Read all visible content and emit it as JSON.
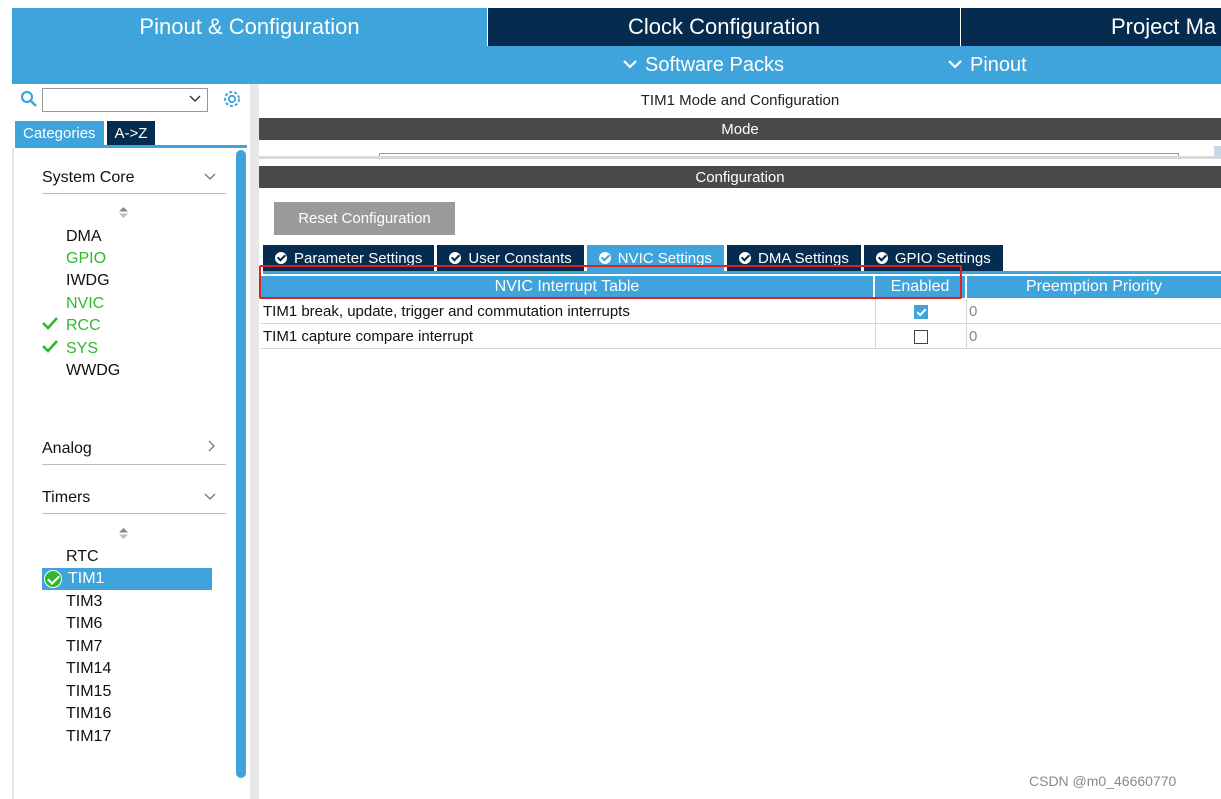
{
  "top_tabs": [
    {
      "label": "Pinout & Configuration"
    },
    {
      "label": "Clock Configuration"
    },
    {
      "label": "Project Ma"
    }
  ],
  "sub_menu": {
    "software_packs": "Software Packs",
    "pinout": "Pinout"
  },
  "sidebar": {
    "categories_tab": "Categories",
    "az_tab": "A->Z",
    "groups": {
      "system_core": {
        "label": "System Core",
        "items": [
          {
            "label": "DMA"
          },
          {
            "label": "GPIO"
          },
          {
            "label": "IWDG"
          },
          {
            "label": "NVIC"
          },
          {
            "label": "RCC"
          },
          {
            "label": "SYS"
          },
          {
            "label": "WWDG"
          }
        ]
      },
      "analog": {
        "label": "Analog"
      },
      "timers": {
        "label": "Timers",
        "items": [
          {
            "label": "RTC"
          },
          {
            "label": "TIM1"
          },
          {
            "label": "TIM3"
          },
          {
            "label": "TIM6"
          },
          {
            "label": "TIM7"
          },
          {
            "label": "TIM14"
          },
          {
            "label": "TIM15"
          },
          {
            "label": "TIM16"
          },
          {
            "label": "TIM17"
          }
        ]
      }
    }
  },
  "main": {
    "title": "TIM1 Mode and Configuration",
    "mode_label": "Mode",
    "configuration_label": "Configuration",
    "reset_button": "Reset Configuration",
    "tabs": [
      {
        "label": "Parameter Settings"
      },
      {
        "label": "User Constants"
      },
      {
        "label": "NVIC Settings"
      },
      {
        "label": "DMA Settings"
      },
      {
        "label": "GPIO Settings"
      }
    ],
    "active_tab": "NVIC Settings",
    "table": {
      "headers": [
        "NVIC Interrupt Table",
        "Enabled",
        "Preemption Priority"
      ],
      "rows": [
        {
          "name": "TIM1 break, update, trigger and commutation interrupts",
          "enabled": true,
          "priority": "0"
        },
        {
          "name": "TIM1 capture compare interrupt",
          "enabled": false,
          "priority": "0"
        }
      ]
    }
  },
  "watermark": "CSDN @m0_46660770",
  "colors": {
    "accent_blue": "#3ea4db",
    "dark_navy": "#052b4f",
    "success_green": "#2eb82e",
    "annotation_red": "#e02020"
  }
}
